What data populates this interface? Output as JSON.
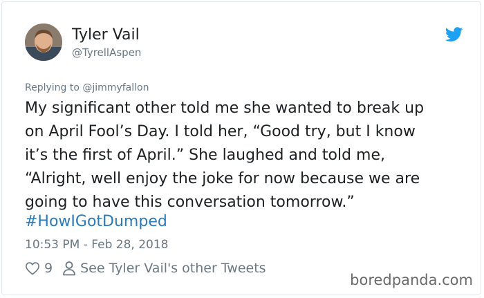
{
  "author": {
    "name": "Tyler Vail",
    "handle": "@TyrellAspen"
  },
  "reply": {
    "prefix": "Replying to ",
    "mention": "@jimmyfallon"
  },
  "tweet": {
    "text": "My significant other told me she wanted to break up\non April Fool’s Day. I told her, “Good try, but I know\nit’s the first of April.” She laughed and told me,\n“Alright, well enjoy the joke for now because we are\ngoing to have this conversation tomorrow.”",
    "hashtag": "#HowIGotDumped",
    "timestamp": "10:53 PM - Feb 28, 2018"
  },
  "actions": {
    "like_count": "9",
    "profile_link": "See Tyler Vail's other Tweets"
  },
  "watermark": "boredpanda.com",
  "colors": {
    "twitter_blue": "#1da1f2",
    "link_blue": "#2b7bb9",
    "secondary_text": "#697882"
  },
  "icons": {
    "brand": "twitter-bird-icon",
    "like": "heart-icon",
    "profile": "person-icon"
  }
}
